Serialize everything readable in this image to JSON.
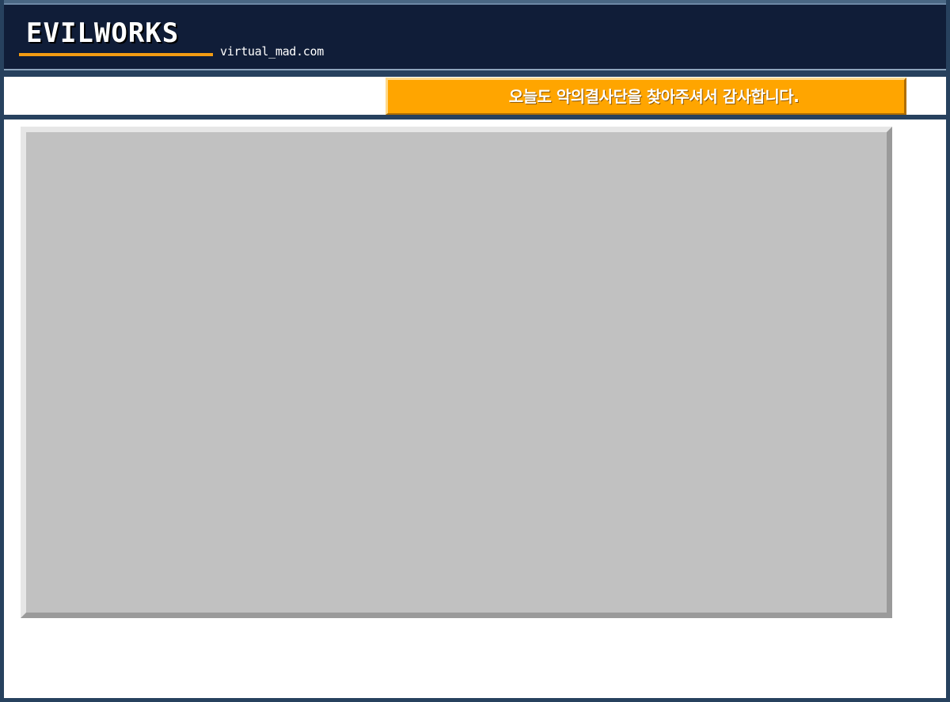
{
  "header": {
    "logo_text": "EVILWORKS",
    "domain_text": "virtual_mad.com",
    "background_color": "#101d38",
    "underline_color": "#f39c12"
  },
  "banner": {
    "message": "오늘도 악의결사단을 찾아주셔서 감사합니다.",
    "background_color": "#ffa500"
  },
  "content": {
    "panel_color": "#c1c1c1"
  }
}
